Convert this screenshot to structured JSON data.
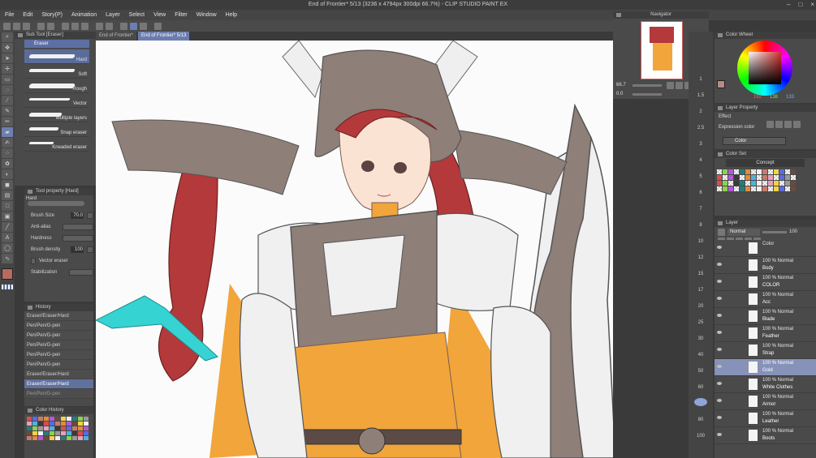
{
  "window": {
    "title": "End of Frontier* 5/13 (3236 x 4794px 300dpi 66.7%) - CLIP STUDIO PAINT EX"
  },
  "menu": [
    "File",
    "Edit",
    "Story(P)",
    "Animation",
    "Layer",
    "Select",
    "View",
    "Filter",
    "Window",
    "Help"
  ],
  "tabs": [
    "End of Frontier*",
    "End of Frontier* 5/13"
  ],
  "subtool": {
    "title": "Sub Tool [Eraser]",
    "tab": "Eraser",
    "brushes": [
      "Hard",
      "Soft",
      "Rough",
      "Vector",
      "Multiple layers",
      "Snap eraser",
      "Kneaded eraser"
    ]
  },
  "toolprop": {
    "title": "Tool property [Hard]",
    "name": "Hard",
    "brush_size_label": "Brush Size",
    "brush_size_value": "70.0",
    "anti_alias_label": "Anti-alias",
    "hardness_label": "Hardness",
    "density_label": "Brush density",
    "density_value": "100",
    "vector_label": "Vector eraser",
    "stabilization_label": "Stabilization"
  },
  "history": {
    "title": "History",
    "items": [
      "Eraser/Eraser/Hard",
      "Pen/Pen/G-pen",
      "Pen/Pen/G-pen",
      "Pen/Pen/G-pen",
      "Pen/Pen/G-pen",
      "Pen/Pen/G-pen",
      "Eraser/Eraser/Hard",
      "Eraser/Eraser/Hard",
      "Pen/Pen/G-pen"
    ]
  },
  "color_history": {
    "title": "Color History"
  },
  "navigator": {
    "title": "Navigator",
    "zoom": "66.7",
    "angle": "0.0"
  },
  "color_wheel": {
    "title": "Color Wheel",
    "values": [
      "162",
      "138",
      "133"
    ]
  },
  "layer_property": {
    "title": "Layer Property",
    "effect": "Effect",
    "expression_label": "Expression color",
    "expression_value": "Color"
  },
  "color_set": {
    "title": "Color Set",
    "set_name": "Concept"
  },
  "layer_panel": {
    "title": "Layer",
    "blend": "Normal",
    "opacity": "100",
    "layers": [
      {
        "mode": "Color",
        "name": ""
      },
      {
        "mode": "100 % Normal",
        "name": "Body"
      },
      {
        "mode": "100 % Normal",
        "name": "COLOR"
      },
      {
        "mode": "100 % Normal",
        "name": "Acc"
      },
      {
        "mode": "100 % Normal",
        "name": "Blade"
      },
      {
        "mode": "100 % Normal",
        "name": "Feather"
      },
      {
        "mode": "100 % Normal",
        "name": "Strap"
      },
      {
        "mode": "100 % Normal",
        "name": "Gold"
      },
      {
        "mode": "100 % Normal",
        "name": "White Clothes"
      },
      {
        "mode": "100 % Normal",
        "name": "Armor"
      },
      {
        "mode": "100 % Normal",
        "name": "Leather"
      },
      {
        "mode": "100 % Normal",
        "name": "Boots"
      },
      {
        "mode": "100 % Normal",
        "name": ""
      }
    ]
  },
  "ruler": {
    "ticks": [
      "1",
      "1.5",
      "2",
      "2.5",
      "3",
      "4",
      "5",
      "6",
      "7",
      "8",
      "10",
      "12",
      "15",
      "17",
      "20",
      "25",
      "30",
      "40",
      "50",
      "60",
      "70",
      "80",
      "100"
    ]
  },
  "colors": {
    "accent": "#6b7cae",
    "hair": "#b33a3a",
    "armor": "#8a7a73",
    "orange": "#f1a33a",
    "ribbon": "#34d6d6"
  }
}
